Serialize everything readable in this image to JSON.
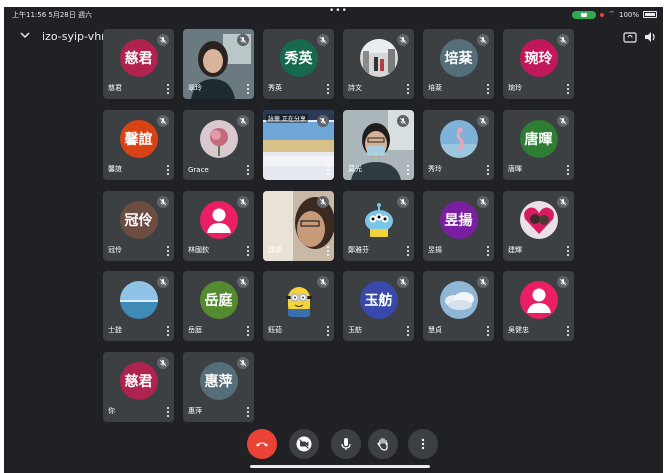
{
  "status_bar": {
    "time": "上午11:56  5月28日 週六",
    "battery": "100%"
  },
  "meeting": {
    "code": "izo-syip-vhm ▸"
  },
  "participants": [
    {
      "name": "慈君",
      "initials": "慈君",
      "avatar_color": "#b0234f",
      "type": "initials"
    },
    {
      "name": "翠玲",
      "type": "video",
      "video": "woman-webcam"
    },
    {
      "name": "秀英",
      "initials": "秀英",
      "avatar_color": "#17694d",
      "type": "initials"
    },
    {
      "name": "詩文",
      "type": "photo",
      "photo": "street-photo"
    },
    {
      "name": "培棻",
      "initials": "培棻",
      "avatar_color": "#546e7a",
      "type": "initials"
    },
    {
      "name": "琬玲",
      "initials": "琬玲",
      "avatar_color": "#c2185b",
      "type": "initials"
    },
    {
      "name": "馨誼",
      "initials": "馨誼",
      "avatar_color": "#d84315",
      "type": "initials"
    },
    {
      "name": "Grace",
      "type": "photo",
      "photo": "flower-photo"
    },
    {
      "name": "",
      "type": "video",
      "video": "screen-share",
      "overlay_text": "詠華 正在分享"
    },
    {
      "name": "莫光",
      "type": "video",
      "video": "man-mask"
    },
    {
      "name": "秀玲",
      "type": "photo",
      "photo": "flamingo-photo"
    },
    {
      "name": "唐暉",
      "initials": "唐暉",
      "avatar_color": "#2e7d32",
      "type": "initials"
    },
    {
      "name": "冠伶",
      "initials": "冠伶",
      "avatar_color": "#6d4c41",
      "type": "initials"
    },
    {
      "name": "林國欽",
      "type": "person",
      "avatar_color": "#e91e63"
    },
    {
      "name": "建福",
      "type": "video",
      "video": "man-closeup"
    },
    {
      "name": "鄭雅芬",
      "type": "photo",
      "photo": "alien-photo"
    },
    {
      "name": "昱揚",
      "initials": "昱揚",
      "avatar_color": "#7b1fa2",
      "type": "initials"
    },
    {
      "name": "建輝",
      "type": "photo",
      "photo": "heart-photo"
    },
    {
      "name": "士銓",
      "type": "photo",
      "photo": "sea-photo"
    },
    {
      "name": "岳庭",
      "initials": "岳庭",
      "avatar_color": "#558b2f",
      "type": "initials"
    },
    {
      "name": "鈺茹",
      "type": "photo",
      "photo": "minion-photo"
    },
    {
      "name": "玉舫",
      "initials": "玉舫",
      "avatar_color": "#3949ab",
      "type": "initials"
    },
    {
      "name": "慧貞",
      "type": "photo",
      "photo": "cloud-photo"
    },
    {
      "name": "吳健忠",
      "type": "person",
      "avatar_color": "#e91e63"
    },
    {
      "name": "你",
      "initials": "慈君",
      "avatar_color": "#b0234f",
      "type": "initials"
    },
    {
      "name": "惠萍",
      "initials": "惠萍",
      "avatar_color": "#546e7a",
      "type": "initials"
    }
  ],
  "controls": {
    "hangup": "hangup-icon",
    "camera": "camera-off-icon",
    "mic": "mic-icon",
    "hand": "raise-hand-icon",
    "more": "more-vert-icon"
  }
}
